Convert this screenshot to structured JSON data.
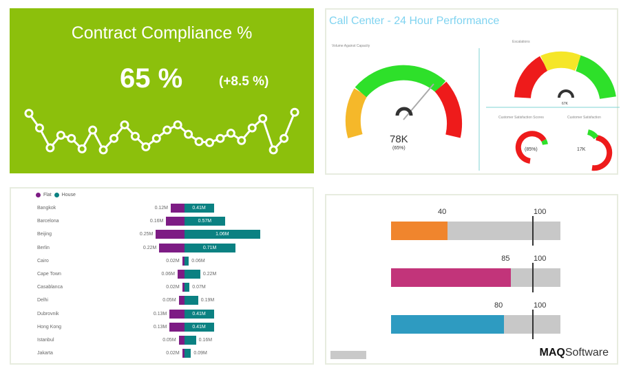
{
  "compliance": {
    "title": "Contract Compliance %",
    "value": "65 %",
    "delta": "(+8.5 %)",
    "sparkline": [
      0.78,
      0.5,
      0.12,
      0.36,
      0.3,
      0.1,
      0.46,
      0.08,
      0.3,
      0.56,
      0.34,
      0.14,
      0.3,
      0.46,
      0.56,
      0.38,
      0.24,
      0.22,
      0.3,
      0.4,
      0.26,
      0.5,
      0.68,
      0.08,
      0.3,
      0.8
    ],
    "color": "#8cc00c"
  },
  "callcenter": {
    "title": "Call Center - 24 Hour Performance",
    "subtitle_left": "Volume Against Capacity",
    "subtitle_right": "Escalations",
    "sat_left": "Customer Satisfaction Scores",
    "sat_right": "Customer Satisfaction",
    "gauge_value": "78K",
    "gauge_pct": "(65%)",
    "small_gauge_1": "67K",
    "small_gauge_2": "(85%)",
    "small_gauge_3": "17K"
  },
  "bars": {
    "legend_flat": "Flat",
    "legend_house": "House",
    "flat_color": "#7d1c84",
    "house_color": "#0b8182",
    "rows": [
      {
        "city": "Bangkok",
        "flat": "0.12M",
        "house": "0.41M",
        "flat_v": 0.12,
        "house_v": 0.41
      },
      {
        "city": "Barcelona",
        "flat": "0.16M",
        "house": "0.57M",
        "flat_v": 0.16,
        "house_v": 0.57
      },
      {
        "city": "Beijing",
        "flat": "0.25M",
        "house": "1.06M",
        "flat_v": 0.25,
        "house_v": 1.06
      },
      {
        "city": "Berlin",
        "flat": "0.22M",
        "house": "0.71M",
        "flat_v": 0.22,
        "house_v": 0.71
      },
      {
        "city": "Cairo",
        "flat": "0.02M",
        "house": "0.06M",
        "flat_v": 0.02,
        "house_v": 0.06
      },
      {
        "city": "Cape Town",
        "flat": "0.06M",
        "house": "0.22M",
        "flat_v": 0.06,
        "house_v": 0.22
      },
      {
        "city": "Casablanca",
        "flat": "0.02M",
        "house": "0.07M",
        "flat_v": 0.02,
        "house_v": 0.07
      },
      {
        "city": "Delhi",
        "flat": "0.05M",
        "house": "0.19M",
        "flat_v": 0.05,
        "house_v": 0.19
      },
      {
        "city": "Dubrovnik",
        "flat": "0.13M",
        "house": "0.41M",
        "flat_v": 0.13,
        "house_v": 0.41
      },
      {
        "city": "Hong Kong",
        "flat": "0.13M",
        "house": "0.41M",
        "flat_v": 0.13,
        "house_v": 0.41
      },
      {
        "city": "Istanbul",
        "flat": "0.05M",
        "house": "0.16M",
        "flat_v": 0.05,
        "house_v": 0.16
      },
      {
        "city": "Jakarta",
        "flat": "0.02M",
        "house": "0.09M",
        "flat_v": 0.02,
        "house_v": 0.09
      }
    ]
  },
  "bullets": {
    "items": [
      {
        "value": 40,
        "target": 100,
        "value_label": "40",
        "target_label": "100",
        "color": "#f0852d"
      },
      {
        "value": 85,
        "target": 100,
        "value_label": "85",
        "target_label": "100",
        "color": "#c2347a"
      },
      {
        "value": 80,
        "target": 100,
        "value_label": "80",
        "target_label": "100",
        "color": "#2e9bc1"
      }
    ],
    "max": 120
  },
  "brand": {
    "logo_bold": "MAQ",
    "logo_rest": "Software"
  }
}
